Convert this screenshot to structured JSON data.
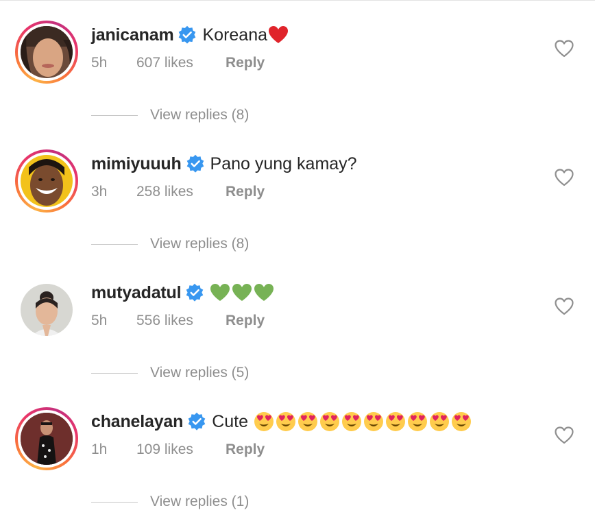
{
  "comments": [
    {
      "username": "janicanam",
      "text": "Koreana",
      "emoji": [
        "red-heart"
      ],
      "time": "5h",
      "likes": "607 likes",
      "reply_label": "Reply",
      "view_replies": "View replies (8)",
      "story_ring": true
    },
    {
      "username": "mimiyuuuh",
      "text": "Pano yung kamay?",
      "emoji": [],
      "time": "3h",
      "likes": "258 likes",
      "reply_label": "Reply",
      "view_replies": "View replies (8)",
      "story_ring": true
    },
    {
      "username": "mutyadatul",
      "text": "",
      "emoji": [
        "green-heart",
        "green-heart",
        "green-heart"
      ],
      "time": "5h",
      "likes": "556 likes",
      "reply_label": "Reply",
      "view_replies": "View replies (5)",
      "story_ring": false
    },
    {
      "username": "chanelayan",
      "text": "Cute",
      "emoji": [
        "heart-eyes",
        "heart-eyes",
        "heart-eyes",
        "heart-eyes",
        "heart-eyes",
        "heart-eyes",
        "heart-eyes",
        "heart-eyes",
        "heart-eyes",
        "heart-eyes"
      ],
      "time": "1h",
      "likes": "109 likes",
      "reply_label": "Reply",
      "view_replies": "View replies (1)",
      "story_ring": true
    }
  ],
  "colors": {
    "verified_badge": "#3897f0",
    "meta_text": "#8e8e8e",
    "username_text": "#262626",
    "red_heart": "#e0242b",
    "green_heart": "#77b255",
    "heart_eyes_face": "#ffcc4d"
  },
  "icons": {
    "verified": "verified-badge-icon",
    "like": "heart-outline-icon"
  }
}
